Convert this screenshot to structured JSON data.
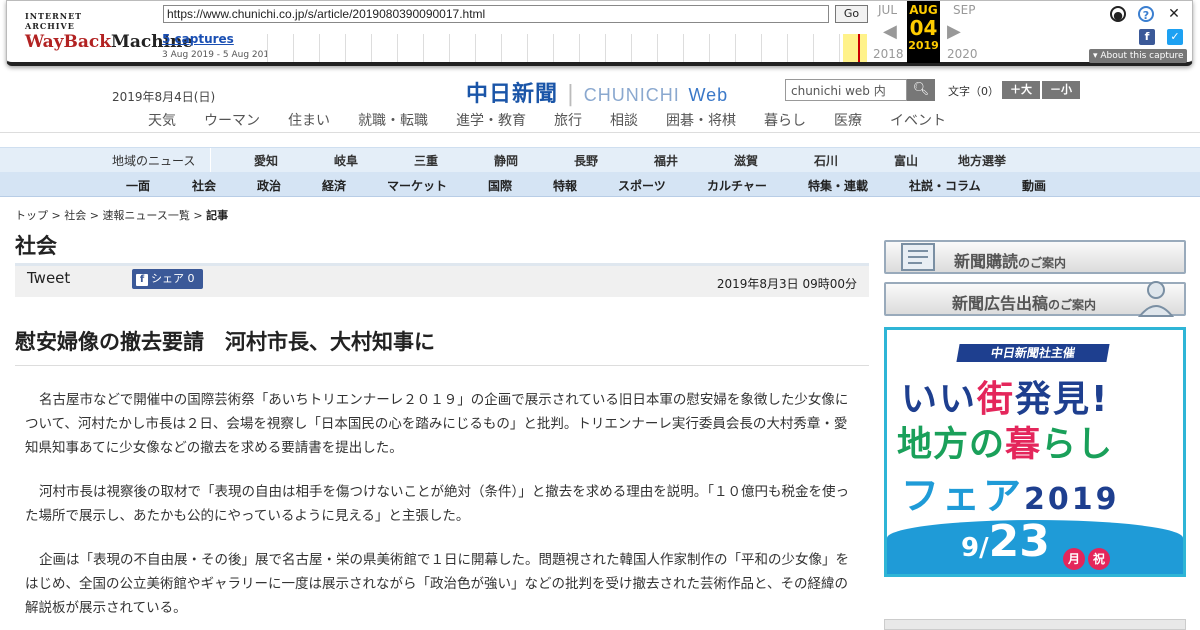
{
  "wayback": {
    "logo_top": "INTERNET ARCHIVE",
    "logo_wayback": "WayBack",
    "logo_machine": "Machine",
    "url": "https://www.chunichi.co.jp/s/article/2019080390090017.html",
    "go_label": "Go",
    "captures_label": "5 captures",
    "capture_range": "3 Aug 2019 - 5 Aug 2019",
    "prev_month": "JUL",
    "cur_month": "AUG",
    "cur_day": "04",
    "cur_year": "2019",
    "next_month": "SEP",
    "prev_year": "2018",
    "next_year": "2020",
    "about_label": "About this capture"
  },
  "header": {
    "date": "2019年8月4日(日)",
    "logo_ja": "中日新聞",
    "logo_sep": "|",
    "logo_en": "CHUNICHI",
    "logo_web": "Web",
    "search_placeholder": "chunichi web 内",
    "font_size_label": "文字（0）",
    "font_bigger": "＋大",
    "font_smaller": "－小"
  },
  "subnav": [
    "天気",
    "ウーマン",
    "住まい",
    "就職・転職",
    "進学・教育",
    "旅行",
    "相談",
    "囲碁・将棋",
    "暮らし",
    "医療",
    "イベント"
  ],
  "region": {
    "title": "地域のニュース",
    "items": [
      "愛知",
      "岐阜",
      "三重",
      "静岡",
      "長野",
      "福井",
      "滋賀",
      "石川",
      "富山",
      "地方選挙"
    ]
  },
  "categories": [
    "一面",
    "社会",
    "政治",
    "経済",
    "マーケット",
    "国際",
    "特報",
    "スポーツ",
    "カルチャー",
    "特集・連載",
    "社説・コラム",
    "動画"
  ],
  "breadcrumb": {
    "items": [
      "トップ",
      "社会",
      "速報ニュース一覧"
    ],
    "current": "記事",
    "sep": " > "
  },
  "article": {
    "section": "社会",
    "tweet_label": "Tweet",
    "fb_share_label": "シェア 0",
    "date": "2019年8月3日 09時00分",
    "headline": "慰安婦像の撤去要請　河村市長、大村知事に",
    "paragraphs": [
      "名古屋市などで開催中の国際芸術祭「あいちトリエンナーレ２０１９」の企画で展示されている旧日本軍の慰安婦を象徴した少女像について、河村たかし市長は２日、会場を視察し「日本国民の心を踏みにじるもの」と批判。トリエンナーレ実行委員会長の大村秀章・愛知県知事あてに少女像などの撤去を求める要請書を提出した。",
      "河村市長は視察後の取材で「表現の自由は相手を傷つけないことが絶対（条件）」と撤去を求める理由を説明。「１０億円も税金を使った場所で展示し、あたかも公的にやっているように見える」と主張した。",
      "企画は「表現の不自由展・その後」展で名古屋・栄の県美術館で１日に開幕した。問題視された韓国人作家制作の「平和の少女像」をはじめ、全国の公立美術館やギャラリーに一度は展示されながら「政治色が強い」などの批判を受け撤去された芸術作品と、その経緯の解説板が展示されている。"
    ]
  },
  "sidebar": {
    "banner1": "新聞購読",
    "banner1_small": "のご案内",
    "banner2": "新聞広告出稿",
    "banner2_small": "のご案内",
    "ad": {
      "organizer": "中日新聞社主催",
      "line1_a": "いい",
      "line1_b": "街",
      "line1_c": "発見!",
      "line2_a": "地方の",
      "line2_b": "暮",
      "line2_c": "らし",
      "line3_a": "フェア",
      "line3_b": "2019",
      "date_month": "9/",
      "date_day": "23",
      "dow1": "月",
      "dow2": "祝"
    }
  },
  "colors": {
    "brand_blue": "#1a55a8",
    "nav_bg": "#d5e4f4",
    "ad_accent": "#e4265b"
  }
}
